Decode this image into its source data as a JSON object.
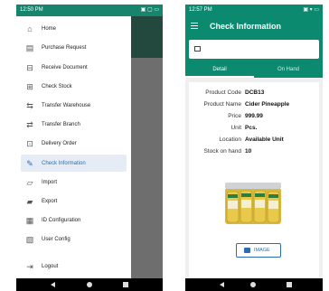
{
  "left_screen": {
    "status": {
      "time": "12:50 PM",
      "icons": "▣ ▢ ▭"
    },
    "menu": [
      {
        "label": "Home",
        "icon": "home-icon",
        "glyph": "⌂"
      },
      {
        "label": "Purchase Request",
        "icon": "document-icon",
        "glyph": "▤"
      },
      {
        "label": "Receive Document",
        "icon": "receive-icon",
        "glyph": "⊟"
      },
      {
        "label": "Check Stock",
        "icon": "stock-icon",
        "glyph": "⊞"
      },
      {
        "label": "Transfer Warehouse",
        "icon": "transfer-warehouse-icon",
        "glyph": "⇆"
      },
      {
        "label": "Transfer Branch",
        "icon": "transfer-branch-icon",
        "glyph": "⇄"
      },
      {
        "label": "Delivery Order",
        "icon": "delivery-icon",
        "glyph": "⊡"
      },
      {
        "label": "Check Information",
        "icon": "info-icon",
        "glyph": "✎",
        "active": true
      },
      {
        "label": "Import",
        "icon": "import-icon",
        "glyph": "▱"
      },
      {
        "label": "Export",
        "icon": "export-icon",
        "glyph": "▰"
      },
      {
        "label": "ID Configuration",
        "icon": "id-config-icon",
        "glyph": "▦"
      },
      {
        "label": "User Config",
        "icon": "user-config-icon",
        "glyph": "▧"
      },
      {
        "label": "Logout",
        "icon": "logout-icon",
        "glyph": "⇥"
      }
    ]
  },
  "right_screen": {
    "status": {
      "time": "12:57 PM",
      "icons": "▣ ▾ ▭"
    },
    "title": "Check Information",
    "tabs": [
      "Detail",
      "On Hand"
    ],
    "selected_tab": "Detail",
    "details": [
      {
        "label": "Product Code",
        "value": "DCB13"
      },
      {
        "label": "Product Name",
        "value": "Cider Pineapple"
      },
      {
        "label": "Price",
        "value": "999.99"
      },
      {
        "label": "Unit",
        "value": "Pcs."
      },
      {
        "label": "Location",
        "value": "Available Unit"
      },
      {
        "label": "Stock on hand",
        "value": "10"
      }
    ],
    "image_button": "IMAGE"
  },
  "colors": {
    "primary": "#0c8a70",
    "accent_blue": "#2a6db5",
    "active_menu_bg": "#e5ecf5"
  }
}
